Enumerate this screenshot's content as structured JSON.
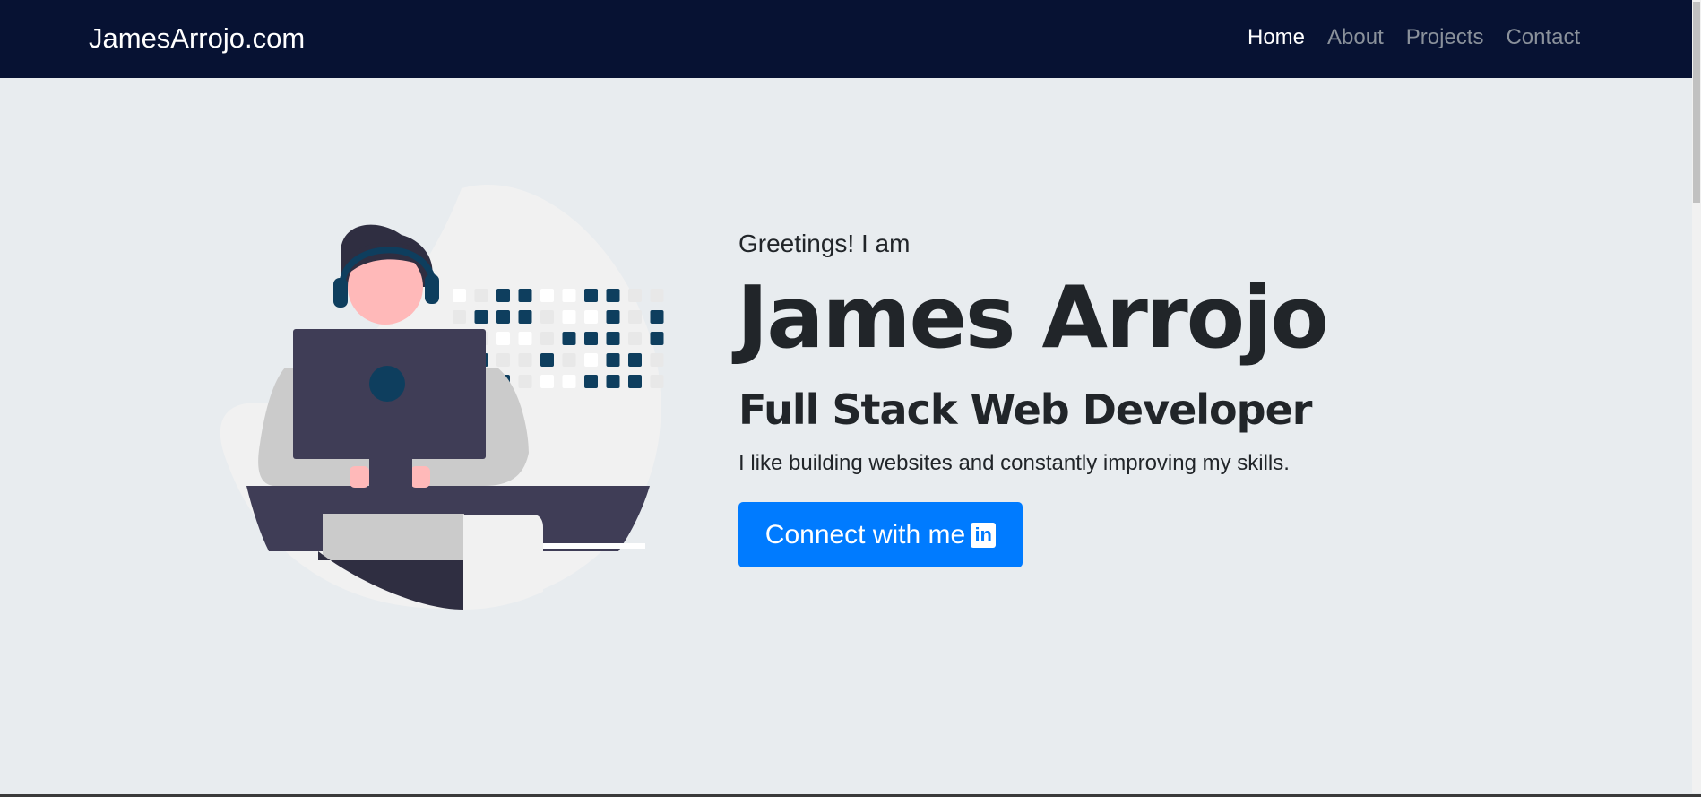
{
  "navbar": {
    "brand": "JamesArrojo.com",
    "links": [
      {
        "label": "Home",
        "active": true
      },
      {
        "label": "About",
        "active": false
      },
      {
        "label": "Projects",
        "active": false
      },
      {
        "label": "Contact",
        "active": false
      }
    ]
  },
  "hero": {
    "greeting": "Greetings! I am",
    "name": "James Arrojo",
    "role": "Full Stack Web Developer",
    "tagline": "I like building websites and constantly improving my skills.",
    "cta_label": "Connect with me",
    "cta_icon": "linkedin-icon",
    "illustration": "developer-at-computer-illustration"
  },
  "colors": {
    "navbar_bg": "#071233",
    "page_bg": "#e8ecef",
    "cta_bg": "#007bff",
    "illustration_accent": "#0e3e5e"
  }
}
